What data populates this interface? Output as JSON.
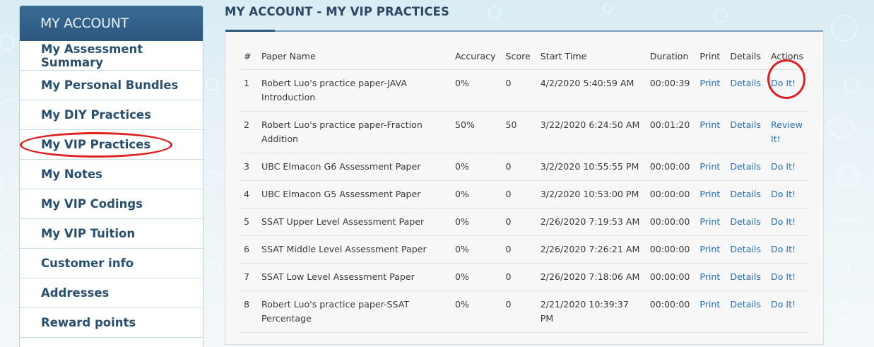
{
  "sidebar": {
    "header": "MY ACCOUNT",
    "items": [
      {
        "label": "My Assessment Summary"
      },
      {
        "label": "My Personal Bundles"
      },
      {
        "label": "My DIY Practices"
      },
      {
        "label": "My VIP Practices",
        "highlighted": true
      },
      {
        "label": "My Notes"
      },
      {
        "label": "My VIP Codings"
      },
      {
        "label": "My VIP Tuition"
      },
      {
        "label": "Customer info"
      },
      {
        "label": "Addresses"
      },
      {
        "label": "Reward points"
      }
    ]
  },
  "page_title": "MY ACCOUNT - MY VIP PRACTICES",
  "table": {
    "headers": [
      "#",
      "Paper Name",
      "Accuracy",
      "Score",
      "Start Time",
      "Duration",
      "Print",
      "Details",
      "Actions"
    ],
    "rows": [
      {
        "num": "1",
        "paper_name": "Robert Luo's practice paper-JAVA Introduction",
        "accuracy": "0%",
        "score": "0",
        "start_time": "4/2/2020 5:40:59 AM",
        "duration": "00:00:39",
        "print": "Print",
        "details": "Details",
        "action": "Do It!",
        "circled": true
      },
      {
        "num": "2",
        "paper_name": "Robert Luo's practice paper-Fraction Addition",
        "accuracy": "50%",
        "score": "50",
        "start_time": "3/22/2020 6:24:50 AM",
        "duration": "00:01:20",
        "print": "Print",
        "details": "Details",
        "action": "Review It!"
      },
      {
        "num": "3",
        "paper_name": "UBC Elmacon G6 Assessment Paper",
        "accuracy": "0%",
        "score": "0",
        "start_time": "3/2/2020 10:55:55 PM",
        "duration": "00:00:00",
        "print": "Print",
        "details": "Details",
        "action": "Do It!"
      },
      {
        "num": "4",
        "paper_name": "UBC Elmacon G5 Assessment Paper",
        "accuracy": "0%",
        "score": "0",
        "start_time": "3/2/2020 10:53:00 PM",
        "duration": "00:00:00",
        "print": "Print",
        "details": "Details",
        "action": "Do It!"
      },
      {
        "num": "5",
        "paper_name": "SSAT Upper Level Assessment Paper",
        "accuracy": "0%",
        "score": "0",
        "start_time": "2/26/2020 7:19:53 AM",
        "duration": "00:00:00",
        "print": "Print",
        "details": "Details",
        "action": "Do It!"
      },
      {
        "num": "6",
        "paper_name": "SSAT Middle Level Assessment Paper",
        "accuracy": "0%",
        "score": "0",
        "start_time": "2/26/2020 7:26:21 AM",
        "duration": "00:00:00",
        "print": "Print",
        "details": "Details",
        "action": "Do It!"
      },
      {
        "num": "7",
        "paper_name": "SSAT Low Level Assessment Paper",
        "accuracy": "0%",
        "score": "0",
        "start_time": "2/26/2020 7:18:06 AM",
        "duration": "00:00:00",
        "print": "Print",
        "details": "Details",
        "action": "Do It!"
      },
      {
        "num": "8",
        "paper_name": "Robert Luo's practice paper-SSAT Percentage",
        "accuracy": "0%",
        "score": "0",
        "start_time": "2/21/2020 10:39:37 PM",
        "duration": "00:00:00",
        "print": "Print",
        "details": "Details",
        "action": "Do It!"
      }
    ]
  },
  "colors": {
    "sidebar_header_bg": "#2c587f",
    "sidebar_text": "#2a4f6e",
    "link": "#2a6fb1",
    "annotation_circle": "#e02020",
    "title_text": "#2a4763"
  }
}
